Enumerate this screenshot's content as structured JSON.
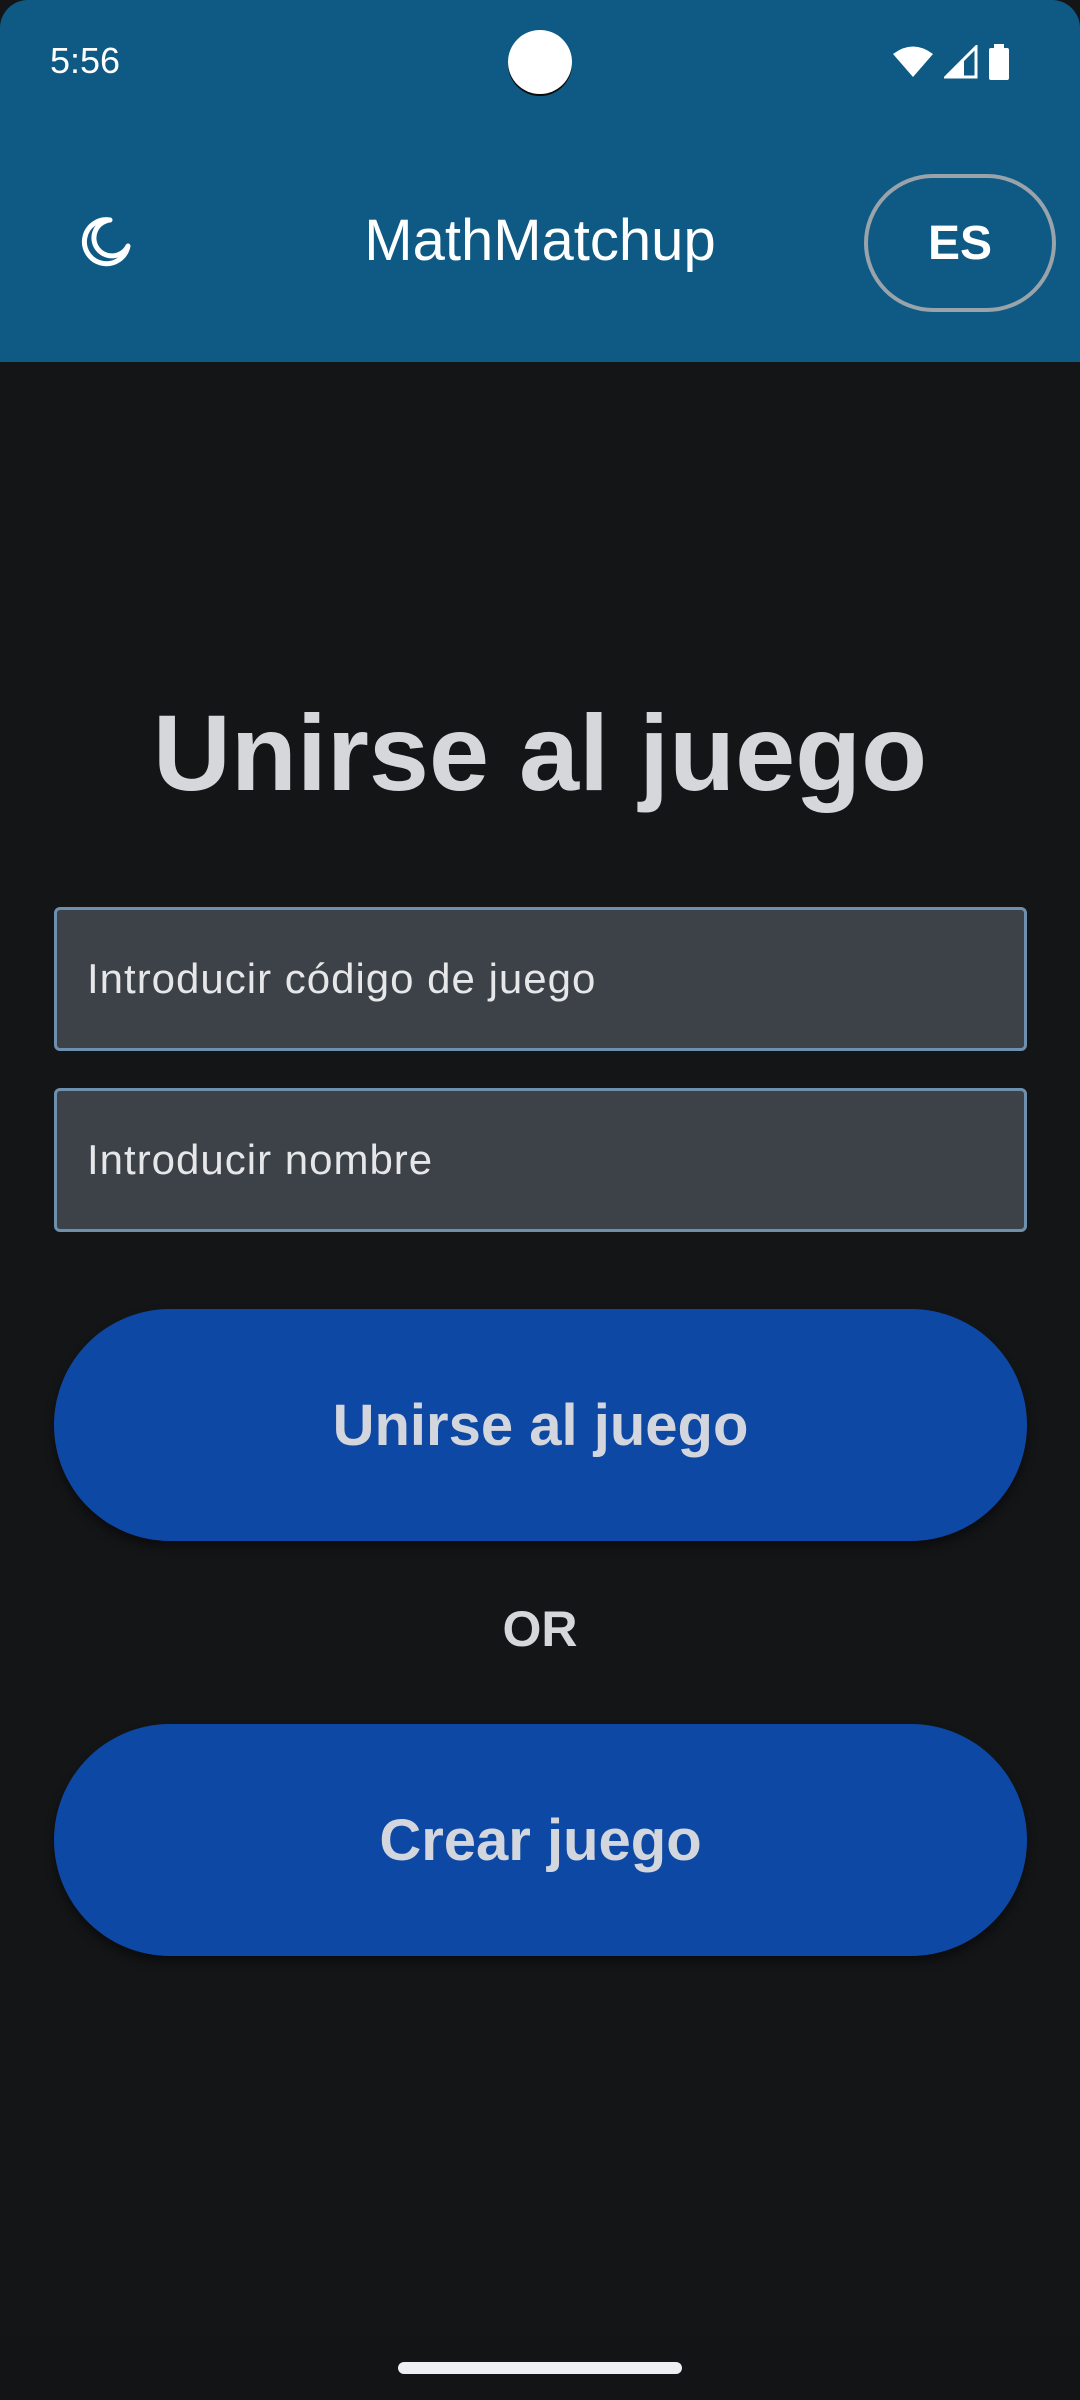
{
  "status_bar": {
    "time": "5:56",
    "icons": [
      "wifi-icon",
      "cell-signal-icon",
      "battery-icon"
    ]
  },
  "app_bar": {
    "title": "MathMatchup",
    "theme_icon": "moon-icon",
    "language_label": "ES"
  },
  "main": {
    "heading": "Unirse al juego",
    "game_code_placeholder": "Introducir código de juego",
    "name_placeholder": "Introducir nombre",
    "join_button_label": "Unirse al juego",
    "or_label": "OR",
    "create_button_label": "Crear juego"
  },
  "colors": {
    "app_bar": "#0e5a84",
    "background": "#141517",
    "button": "#0e48a5",
    "field": "#3d4148",
    "field_border": "#6f8fae"
  }
}
